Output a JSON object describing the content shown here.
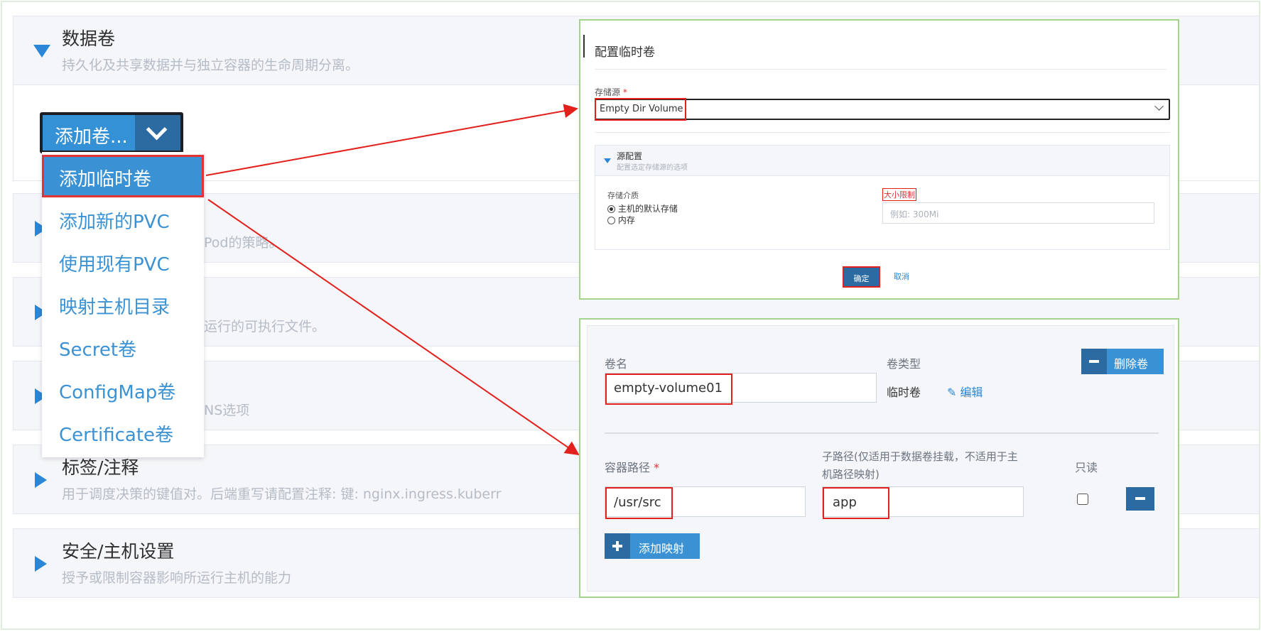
{
  "sections": [
    {
      "title": "数据卷",
      "desc": "持久化及共享数据并与独立容器的生命周期分离。",
      "expanded": true
    },
    {
      "title": "",
      "desc": "调度Pod的策略。",
      "expanded": false
    },
    {
      "title": "",
      "desc": "运行的可执行文件。",
      "expanded": false
    },
    {
      "title": "",
      "desc": "NS选项",
      "expanded": false
    },
    {
      "title": "标签/注释",
      "desc": "用于调度决策的键值对。后端重写请配置注释: 键: nginx.ingress.kuberr",
      "expanded": false
    },
    {
      "title": "安全/主机设置",
      "desc": "授予或限制容器影响所运行主机的能力",
      "expanded": false
    }
  ],
  "add_volume": {
    "label": "添加卷..."
  },
  "menu": {
    "items": [
      "添加临时卷",
      "添加新的PVC",
      "使用现有PVC",
      "映射主机目录",
      "Secret卷",
      "ConfigMap卷",
      "Certificate卷"
    ],
    "active_index": 0
  },
  "dialog": {
    "title": "配置临时卷",
    "source_label": "存储源",
    "required_mark": "*",
    "source_value": "Empty Dir Volume",
    "source_config_title": "源配置",
    "source_config_desc": "配置选定存储源的选项",
    "medium_label": "存储介质",
    "medium_options": [
      "主机的默认存储",
      "内存"
    ],
    "medium_selected": 0,
    "size_label": "大小限制",
    "size_placeholder": "例如: 300Mi",
    "confirm": "确定",
    "cancel": "取消"
  },
  "volume": {
    "name_label": "卷名",
    "name_value": "empty-volume01",
    "type_label": "卷类型",
    "type_value": "临时卷",
    "edit_label": "编辑",
    "delete_label": "删除卷",
    "container_path_label": "容器路径",
    "required_mark": "*",
    "container_path_value": "/usr/src",
    "subpath_label_line1": "子路径(仅适用于数据卷挂载，不适用于主",
    "subpath_label_line2": "机路径映射)",
    "subpath_value": "app",
    "readonly_label": "只读",
    "readonly_checked": false,
    "add_mapping_label": "添加映射"
  },
  "colors": {
    "accent": "#3a92d5",
    "highlight": "#e3201b",
    "arrow": "#e3201b",
    "panel_border": "#a4d38d"
  }
}
